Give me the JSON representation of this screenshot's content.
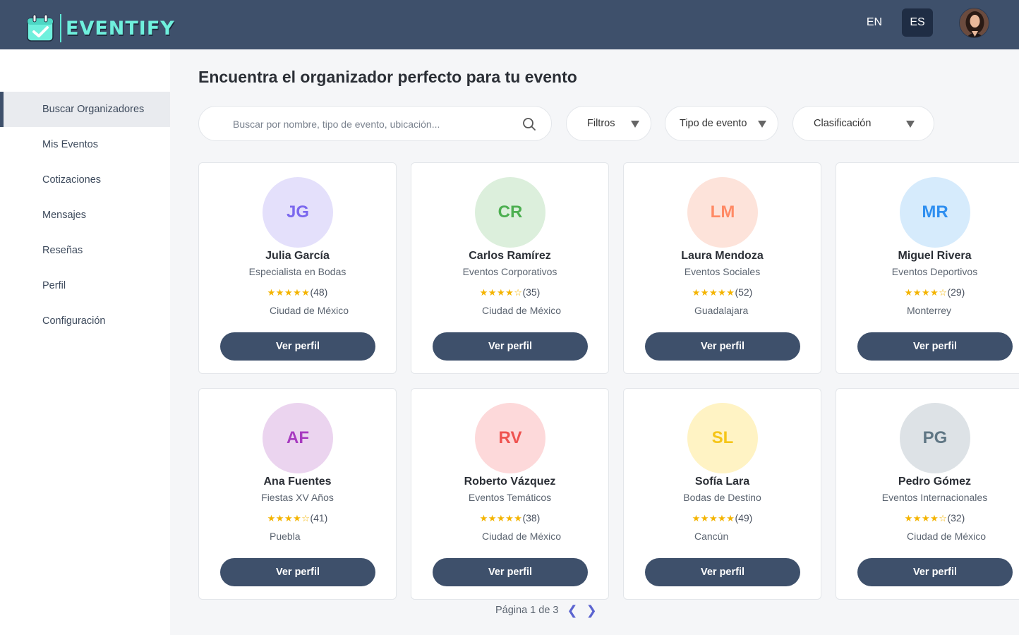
{
  "header": {
    "brand": "EVENTIFY",
    "languages": [
      "EN",
      "ES"
    ],
    "active_language": "ES"
  },
  "sidebar": {
    "items": [
      {
        "label": "Buscar Organizadores",
        "active": true
      },
      {
        "label": "Mis Eventos"
      },
      {
        "label": "Cotizaciones"
      },
      {
        "label": "Mensajes"
      },
      {
        "label": "Reseñas"
      },
      {
        "label": "Perfil"
      },
      {
        "label": "Configuración"
      }
    ]
  },
  "main": {
    "title": "Encuentra el organizador perfecto para tu evento",
    "search": {
      "placeholder": "Buscar por nombre, tipo de evento, ubicación...",
      "value": ""
    },
    "filters": {
      "filtros": "Filtros",
      "tipo": "Tipo de evento",
      "clasificacion": "Clasificación"
    },
    "organizers": [
      {
        "initials": "JG",
        "name": "Julia García",
        "specialty": "Especialista en Bodas",
        "stars": "★★★★★",
        "rating": 5,
        "reviews": "(48)",
        "location": "Ciudad de México",
        "color": "#7b68ee",
        "bg": "#e4e0fb",
        "button": "Ver perfil"
      },
      {
        "initials": "CR",
        "name": "Carlos Ramírez",
        "specialty": "Eventos Corporativos",
        "stars": "★★★★☆",
        "rating": 4.5,
        "reviews": "(35)",
        "location": "Ciudad de México",
        "color": "#4caf50",
        "bg": "#dcefdc",
        "button": "Ver perfil"
      },
      {
        "initials": "LM",
        "name": "Laura Mendoza",
        "specialty": "Eventos Sociales",
        "stars": "★★★★★",
        "rating": 5,
        "reviews": "(52)",
        "location": "Guadalajara",
        "color": "#ff8a65",
        "bg": "#fde3da",
        "button": "Ver perfil"
      },
      {
        "initials": "MR",
        "name": "Miguel Rivera",
        "specialty": "Eventos Deportivos",
        "stars": "★★★★☆",
        "rating": 4.5,
        "reviews": "(29)",
        "location": "Monterrey",
        "color": "#2f8ff0",
        "bg": "#d6ebfc",
        "button": "Ver perfil"
      },
      {
        "initials": "AF",
        "name": "Ana Fuentes",
        "specialty": "Fiestas XV Años",
        "stars": "★★★★☆",
        "rating": 4.5,
        "reviews": "(41)",
        "location": "Puebla",
        "color": "#a83bc0",
        "bg": "#ebd4ef",
        "button": "Ver perfil"
      },
      {
        "initials": "RV",
        "name": "Roberto Vázquez",
        "specialty": "Eventos Temáticos",
        "stars": "★★★★★",
        "rating": 5,
        "reviews": "(38)",
        "location": "Ciudad de México",
        "color": "#ef5350",
        "bg": "#fdd9da",
        "button": "Ver perfil"
      },
      {
        "initials": "SL",
        "name": "Sofía Lara",
        "specialty": "Bodas de Destino",
        "stars": "★★★★★",
        "rating": 5,
        "reviews": "(49)",
        "location": "Cancún",
        "color": "#f5c518",
        "bg": "#fff3c4",
        "button": "Ver perfil"
      },
      {
        "initials": "PG",
        "name": "Pedro Gómez",
        "specialty": "Eventos Internacionales",
        "stars": "★★★★☆",
        "rating": 4.5,
        "reviews": "(32)",
        "location": "Ciudad de México",
        "color": "#5f7684",
        "bg": "#dde2e6",
        "button": "Ver perfil"
      }
    ],
    "pagination": {
      "label": "Página 1 de 3",
      "prev": "❮",
      "next": "❯"
    }
  }
}
